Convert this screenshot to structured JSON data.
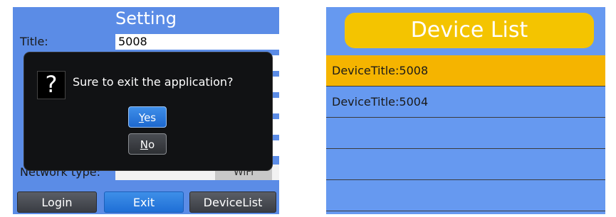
{
  "setting_screen": {
    "header": "Setting",
    "fields": [
      {
        "label": "Title:",
        "value": "5008"
      },
      {
        "label": "",
        "value": ""
      },
      {
        "label": "",
        "value": ""
      },
      {
        "label": "",
        "value": ""
      },
      {
        "label": "",
        "value": ""
      },
      {
        "label": "",
        "value": ""
      }
    ],
    "network": {
      "label": "Network type:",
      "value": "WiFi"
    },
    "buttons": {
      "login": "Login",
      "exit": "Exit",
      "device_list": "DeviceList"
    }
  },
  "dialog": {
    "icon": "question-icon",
    "message": "Sure to exit the application?",
    "yes": "Yes",
    "no": "No"
  },
  "device_list_screen": {
    "title": "Device List",
    "devices": [
      {
        "label": "DeviceTitle:5008",
        "selected": true
      },
      {
        "label": "DeviceTitle:5004",
        "selected": false
      },
      {
        "label": "",
        "selected": false
      },
      {
        "label": "",
        "selected": false
      },
      {
        "label": "",
        "selected": false
      }
    ]
  },
  "colors": {
    "background_blue": "#5b8ce6",
    "list_blue": "#6699f0",
    "highlight": "#f5b400",
    "title_bar": "#f4c400",
    "dialog": "#111214",
    "active_button": "#1f6fd6"
  }
}
